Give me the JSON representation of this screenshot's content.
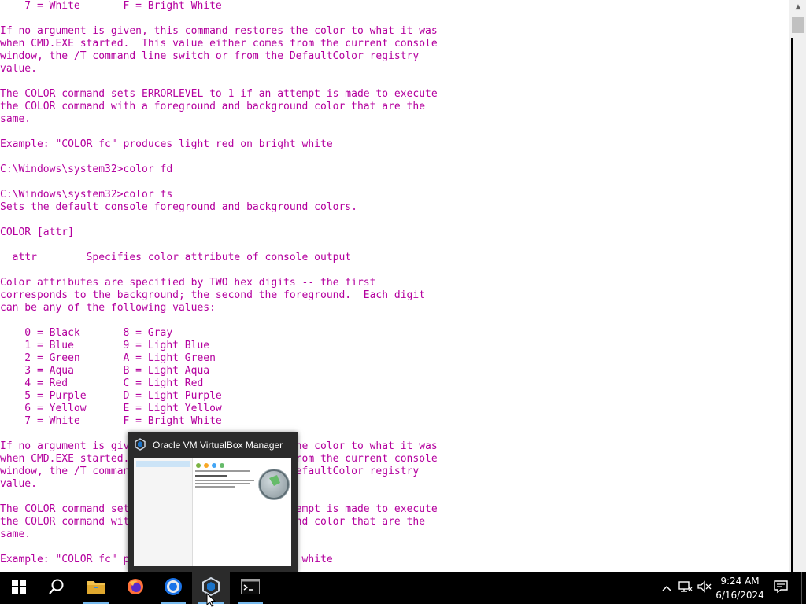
{
  "console": {
    "lines": [
      "    7 = White       F = Bright White",
      "",
      "If no argument is given, this command restores the color to what it was",
      "when CMD.EXE started.  This value either comes from the current console",
      "window, the /T command line switch or from the DefaultColor registry",
      "value.",
      "",
      "The COLOR command sets ERRORLEVEL to 1 if an attempt is made to execute",
      "the COLOR command with a foreground and background color that are the",
      "same.",
      "",
      "Example: \"COLOR fc\" produces light red on bright white",
      "",
      "C:\\Windows\\system32>color fd",
      "",
      "C:\\Windows\\system32>color fs",
      "Sets the default console foreground and background colors.",
      "",
      "COLOR [attr]",
      "",
      "  attr        Specifies color attribute of console output",
      "",
      "Color attributes are specified by TWO hex digits -- the first",
      "corresponds to the background; the second the foreground.  Each digit",
      "can be any of the following values:",
      "",
      "    0 = Black       8 = Gray",
      "    1 = Blue        9 = Light Blue",
      "    2 = Green       A = Light Green",
      "    3 = Aqua        B = Light Aqua",
      "    4 = Red         C = Light Red",
      "    5 = Purple      D = Light Purple",
      "    6 = Yellow      E = Light Yellow",
      "    7 = White       F = Bright White",
      "",
      "If no argument is given, this command restores the color to what it was",
      "when CMD.EXE started.  This value either comes from the current console",
      "window, the /T command line switch or from the DefaultColor registry",
      "value.",
      "",
      "The COLOR command sets ERRORLEVEL to 1 if an attempt is made to execute",
      "the COLOR command with a foreground and background color that are the",
      "same.",
      "",
      "Example: \"COLOR fc\" produces light red on bright white",
      ""
    ],
    "text_color": "#b4009e",
    "background_color": "#ffffff"
  },
  "thumbnail": {
    "title": "Oracle VM VirtualBox Manager",
    "icon": "virtualbox-icon"
  },
  "taskbar": {
    "start_icon": "windows-logo-icon",
    "search_icon": "search-icon",
    "apps": [
      {
        "name": "file-explorer",
        "icon": "folder-icon"
      },
      {
        "name": "firefox",
        "icon": "firefox-icon"
      },
      {
        "name": "chrome",
        "icon": "chrome-icon"
      },
      {
        "name": "virtualbox",
        "icon": "virtualbox-icon"
      },
      {
        "name": "command-prompt",
        "icon": "cmd-icon"
      }
    ],
    "tray": {
      "overflow_icon": "chevron-up-icon",
      "network_icon": "network-icon",
      "volume_icon": "volume-muted-icon",
      "time": "9:24 AM",
      "date": "6/16/2024",
      "notifications_icon": "notification-icon"
    },
    "accent": "#76b9ed"
  }
}
